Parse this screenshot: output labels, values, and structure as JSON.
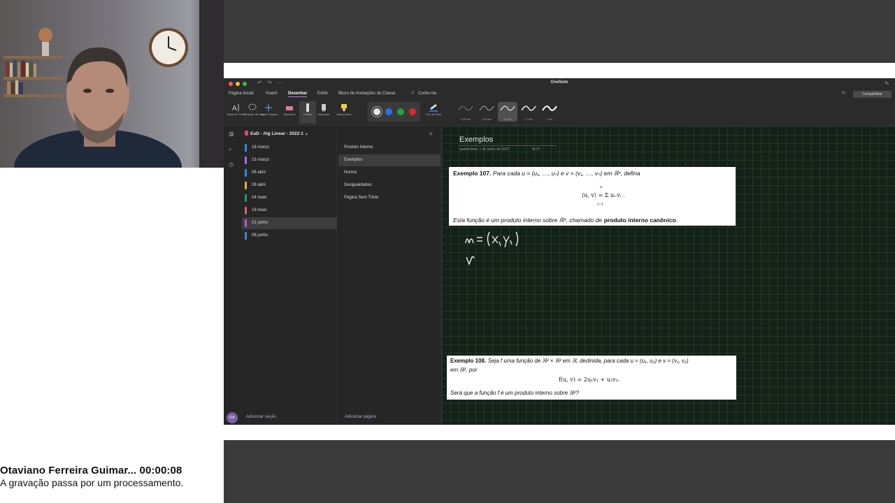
{
  "caption": {
    "line1": "Otaviano Ferreira Guimar... 00:00:08",
    "line2": "A gravação passa por um processamento."
  },
  "window": {
    "title": "OneNote",
    "share_label": "Compartilhar"
  },
  "menu": {
    "tabs": [
      "Página Inicial",
      "Inserir",
      "Desenhar",
      "Exibir",
      "Bloco de Anotações de Classe",
      "Conte-me"
    ],
    "active_tab": "Desenhar"
  },
  "ribbon": {
    "tools": [
      {
        "label": "Modo de Texto",
        "icon": "text-mode-icon"
      },
      {
        "label": "Seleção de Laço",
        "icon": "lasso-icon"
      },
      {
        "label": "Inserir Espaço",
        "icon": "insert-space-icon"
      },
      {
        "label": "Borracha",
        "icon": "eraser-icon"
      },
      {
        "label": "Caneta",
        "icon": "pen-icon"
      },
      {
        "label": "Marcador",
        "icon": "marker-icon"
      },
      {
        "label": "Marca-texto",
        "icon": "highlighter-icon"
      }
    ],
    "colors": [
      "#e6e6e6",
      "#2f6fe0",
      "#1ea83c",
      "#e0262b"
    ],
    "ink_color_label": "Cor da Tinta",
    "thickness": [
      "0.25 mm",
      "0.35 mm",
      "0.5 mm",
      "0.7 mm",
      "1 mm"
    ],
    "selected_thickness": 2
  },
  "notebook": {
    "name": "EaD - Alg Linear - 2022-1",
    "sections": [
      {
        "label": "16 março",
        "color": "#2f8fd6"
      },
      {
        "label": "23 março",
        "color": "#a66cd8"
      },
      {
        "label": "06 abril",
        "color": "#2f8fd6"
      },
      {
        "label": "28 abril",
        "color": "#e8b12a"
      },
      {
        "label": "04 maio",
        "color": "#1f9e5a"
      },
      {
        "label": "18 maio",
        "color": "#e05a6a"
      },
      {
        "label": "01 junho",
        "color": "#c64fd1"
      },
      {
        "label": "08 junho",
        "color": "#2f8fd6"
      }
    ],
    "selected_section": 6,
    "add_section": "Adicionar seção",
    "avatar": "OA"
  },
  "pages": {
    "items": [
      "Produto Interno",
      "Exemplos",
      "Norma",
      "Desigualdades",
      "Página Sem Título"
    ],
    "selected": 1,
    "add_page": "Adicionar página"
  },
  "page": {
    "title": "Exemplos",
    "date": "quarta-feira, 1 de junho de 2022",
    "time": "18:37"
  },
  "example107": {
    "label": "Exemplo 107.",
    "intro": "Para cada u = (u₁, …, uₙ) e v = (v₁, …, vₙ) em ℝⁿ, defina",
    "formula": "⟨u, v⟩ = Σ uᵢ.vᵢ .",
    "sum_top": "n",
    "sum_bottom": "i=1",
    "text_before": "Esta função é um produto interno sobre ℝⁿ, chamado de",
    "bold_term": "produto interno canônico",
    "text_after": "."
  },
  "example108": {
    "label": "Exemplo 108.",
    "line1": "Seja f uma função de ℝ² × ℝ² em ℝ, dedinida, para cada u = (u₁, u₂) e v = (v₁, v₂)",
    "line2": "em ℝ², por",
    "formula": "f(u, v) = 2u₁v₁ + u₂v₂.",
    "question": "Será que a função f é um produto interno sobre ℝ²?"
  }
}
